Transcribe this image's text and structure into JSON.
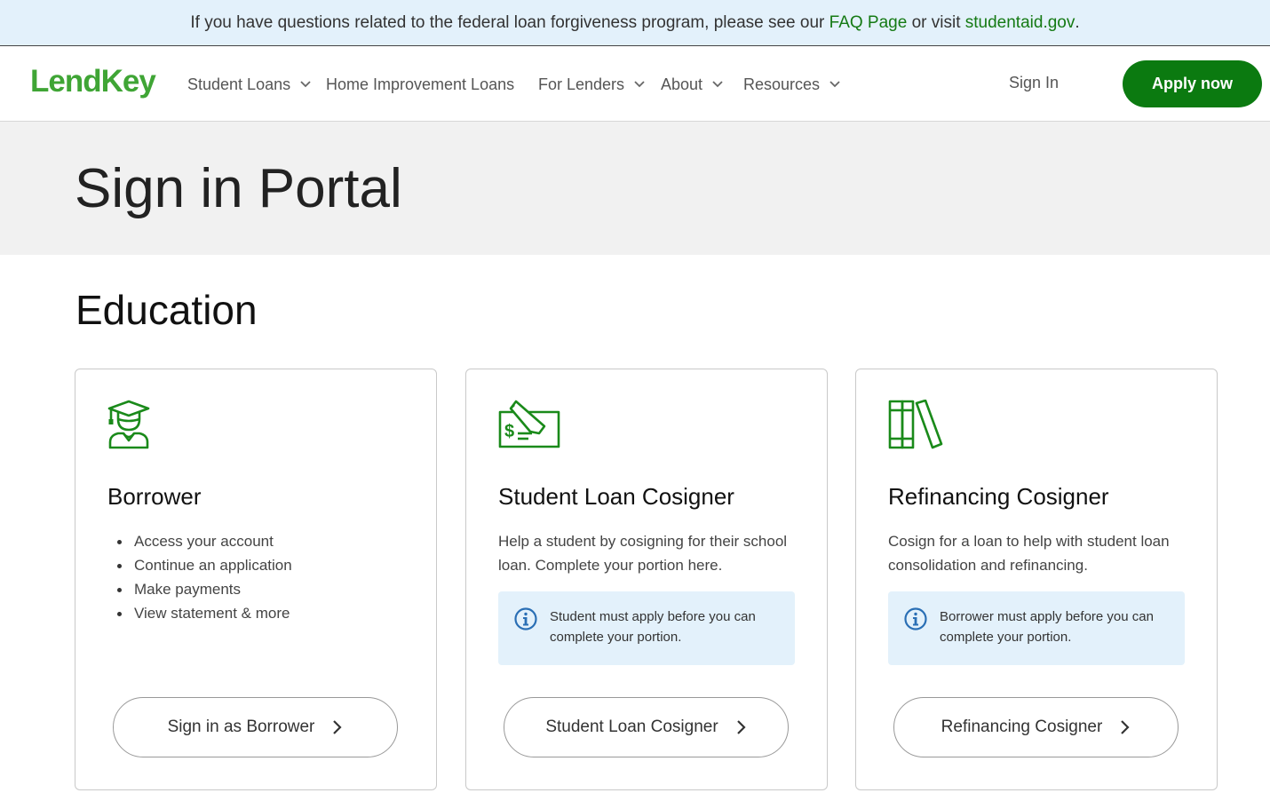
{
  "banner": {
    "text_before": "If you have questions related to the federal loan forgiveness program, please see our ",
    "faq_link": "FAQ Page",
    "text_middle": " or visit ",
    "studentaid_link": "studentaid.gov",
    "text_after": "."
  },
  "nav": {
    "logo": "LendKey",
    "items": [
      {
        "label": "Student Loans",
        "has_dropdown": true
      },
      {
        "label": "Home Improvement Loans",
        "has_dropdown": false
      },
      {
        "label": "For Lenders",
        "has_dropdown": true
      },
      {
        "label": "About",
        "has_dropdown": true
      },
      {
        "label": "Resources",
        "has_dropdown": true
      }
    ],
    "sign_in": "Sign In",
    "apply": "Apply now"
  },
  "hero": {
    "title": "Sign in Portal"
  },
  "section": {
    "title": "Education"
  },
  "cards": [
    {
      "icon": "graduate-icon",
      "title": "Borrower",
      "bullets": [
        "Access your account",
        "Continue an application",
        "Make payments",
        "View statement & more"
      ],
      "button": "Sign in as Borrower"
    },
    {
      "icon": "check-signing-icon",
      "title": "Student Loan Cosigner",
      "description": "Help a student by cosigning for their school loan. Complete your portion here.",
      "info": "Student must apply before you can complete your portion.",
      "button": "Student Loan Cosigner"
    },
    {
      "icon": "books-icon",
      "title": "Refinancing Cosigner",
      "description": "Cosign for a loan to help with student loan consolidation and refinancing.",
      "info": "Borrower must apply before you can complete your portion.",
      "button": "Refinancing Cosigner"
    }
  ],
  "colors": {
    "brand_green": "#0b7a10",
    "logo_green": "#3fa535",
    "icon_green": "#1a8a1a",
    "info_blue": "#2a6fb5",
    "banner_bg": "#e3f1fb",
    "hero_bg": "#f1f1f1"
  }
}
